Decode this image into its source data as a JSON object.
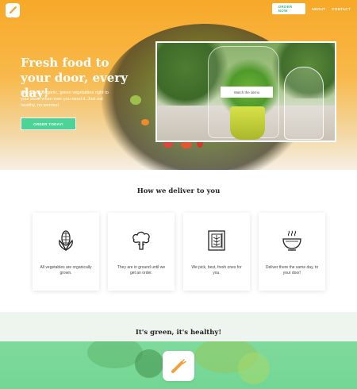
{
  "header": {
    "order_now": "ORDER NOW",
    "nav": [
      "ABOUT",
      "CONTACT"
    ],
    "logo_icon": "carrot-icon"
  },
  "hero": {
    "title": "Fresh food to your door, every day!",
    "description": "We deliver organic, green vegetables right to your door, when ever you need it. Just eat healthy, no worries!",
    "cta": "ORDER TODAY!",
    "video_button": "Watch the demo"
  },
  "delivery": {
    "title": "How we deliver to you",
    "steps": [
      {
        "icon": "corn-icon",
        "text": "All vegetables are organically grown."
      },
      {
        "icon": "broccoli-icon",
        "text": "They are in ground until we get an order."
      },
      {
        "icon": "box-icon",
        "text": "We pick, best, fresh ones for you."
      },
      {
        "icon": "steaming-bowl-icon",
        "text": "Deliver there the same day, to your door!"
      }
    ]
  },
  "healthy": {
    "title": "It's green, it's healthy!",
    "app_icon": "carrot-icon"
  },
  "colors": {
    "accent_green": "#4cd496",
    "hero_orange": "#f7a928"
  }
}
